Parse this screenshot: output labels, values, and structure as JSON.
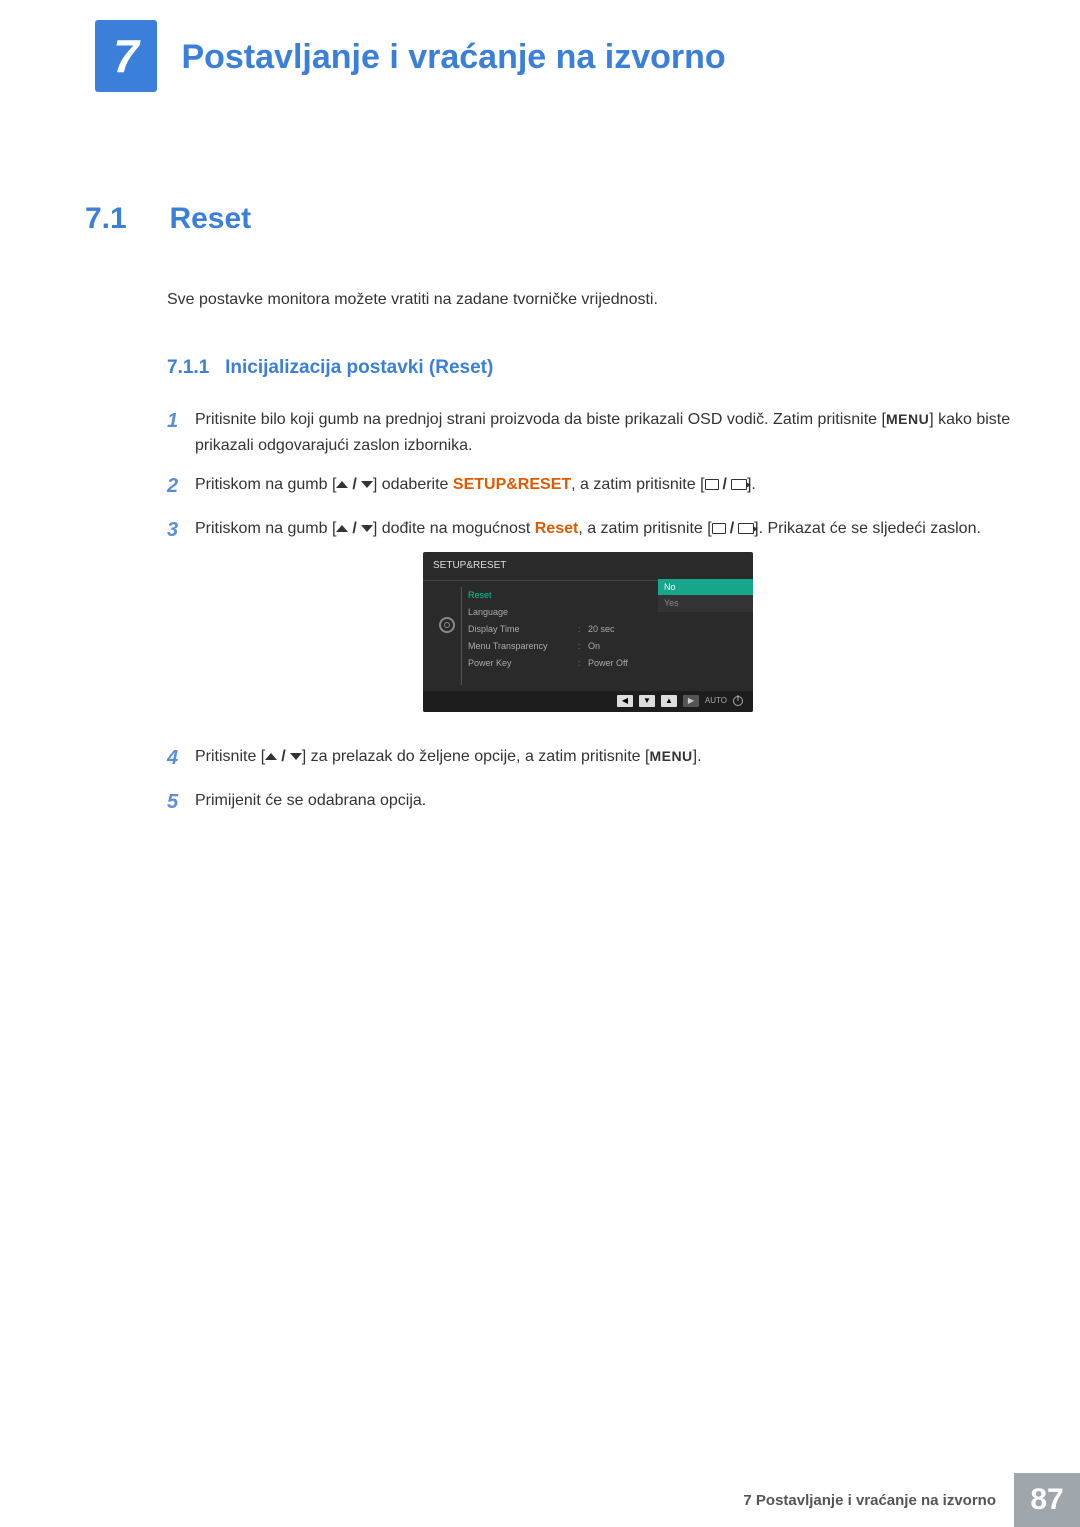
{
  "chapter": {
    "number": "7",
    "title": "Postavljanje i vraćanje na izvorno"
  },
  "section": {
    "number": "7.1",
    "title": "Reset"
  },
  "intro": "Sve postavke monitora možete vratiti na zadane tvorničke vrijednosti.",
  "subsection": {
    "number": "7.1.1",
    "title": "Inicijalizacija postavki (Reset)"
  },
  "steps": {
    "s1a": "Pritisnite bilo koji gumb na prednjoj strani proizvoda da biste prikazali OSD vodič. Zatim pritisnite [",
    "s1_menu": "MENU",
    "s1b": "] kako biste prikazali odgovarajući zaslon izbornika.",
    "s2a": "Pritiskom na gumb [",
    "s2b": "] odaberite ",
    "s2_hl": "SETUP&RESET",
    "s2c": ", a zatim pritisnite [",
    "s2d": "].",
    "s3a": "Pritiskom na gumb [",
    "s3b": "] dođite na mogućnost ",
    "s3_hl": "Reset",
    "s3c": ", a zatim pritisnite [",
    "s3d": "]. Prikazat će se sljedeći zaslon.",
    "s4a": "Pritisnite [",
    "s4b": "] za prelazak do željene opcije, a zatim pritisnite [",
    "s4_menu": "MENU",
    "s4c": "].",
    "s5": "Primijenit će se odabrana opcija."
  },
  "osd": {
    "title": "SETUP&RESET",
    "rows": [
      {
        "label": "Reset",
        "value": "",
        "active": true
      },
      {
        "label": "Language",
        "value": ""
      },
      {
        "label": "Display Time",
        "value": "20 sec"
      },
      {
        "label": "Menu Transparency",
        "value": "On"
      },
      {
        "label": "Power Key",
        "value": "Power Off"
      }
    ],
    "options": {
      "no": "No",
      "yes": "Yes"
    },
    "footer": {
      "auto": "AUTO"
    }
  },
  "footer": {
    "text": "7 Postavljanje i vraćanje na izvorno",
    "page": "87"
  }
}
